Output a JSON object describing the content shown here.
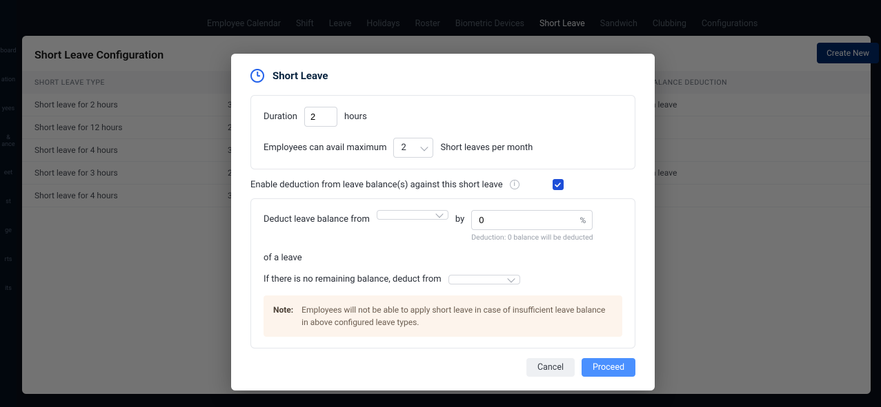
{
  "nav": {
    "items": [
      {
        "label": "Employee Calendar",
        "active": false
      },
      {
        "label": "Shift",
        "active": false
      },
      {
        "label": "Leave",
        "active": false
      },
      {
        "label": "Holidays",
        "active": false
      },
      {
        "label": "Roster",
        "active": false
      },
      {
        "label": "Biometric Devices",
        "active": false
      },
      {
        "label": "Short Leave",
        "active": true
      },
      {
        "label": "Sandwich",
        "active": false
      },
      {
        "label": "Clubbing",
        "active": false
      },
      {
        "label": "Configurations",
        "active": false
      }
    ]
  },
  "sidebar": {
    "items": [
      "board",
      "ation",
      "yees",
      " & ance",
      "eet",
      "st",
      "ge",
      "rts",
      "its"
    ]
  },
  "page": {
    "title": "Short Leave Configuration",
    "create_button": "Create New",
    "columns": {
      "a": "SHORT LEAVE TYPE",
      "b": "",
      "c": "E BALANCE DEDUCTION"
    },
    "rows": [
      {
        "a": "Short leave for 2 hours",
        "b": "3",
        "c": "of a leave"
      },
      {
        "a": "Short leave for 12 hours",
        "b": "2",
        "c": ""
      },
      {
        "a": "Short leave for 4 hours",
        "b": "3",
        "c": ""
      },
      {
        "a": "Short leave for 3 hours",
        "b": "2",
        "c": "of a leave"
      },
      {
        "a": "Short leave for 4 hours",
        "b": "3",
        "c": ""
      }
    ]
  },
  "modal": {
    "title": "Short Leave",
    "duration_label": "Duration",
    "duration_value": "2",
    "duration_unit": "hours",
    "avail_label": "Employees can avail maximum",
    "avail_value": "2",
    "avail_suffix": "Short leaves per month",
    "enable_label": "Enable deduction from leave balance(s) against this short leave",
    "enable_checked": true,
    "deduct_from_label": "Deduct leave balance from",
    "deduct_from_value": "",
    "by_label": "by",
    "deduct_pct_value": "0",
    "pct_symbol": "%",
    "of_leave_label": "of a leave",
    "deduction_helper": "Deduction: 0 balance will be deducted",
    "fallback_label": "If there is no remaining balance, deduct from",
    "fallback_value": "",
    "note_title": "Note:",
    "note_body": "Employees will not be able to apply short leave in case of insufficient leave balance in above configured leave types.",
    "cancel": "Cancel",
    "proceed": "Proceed"
  }
}
